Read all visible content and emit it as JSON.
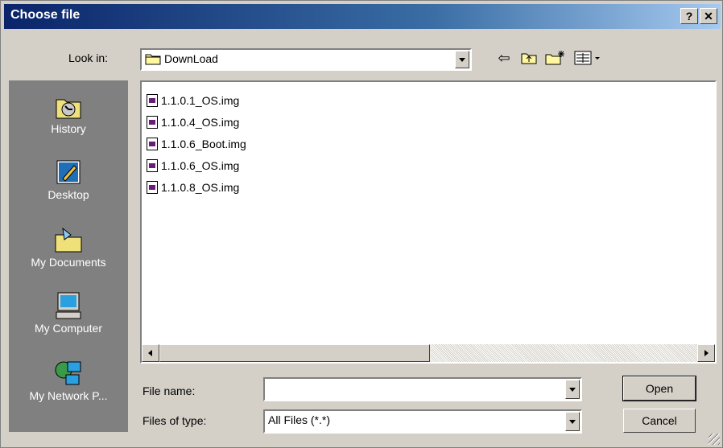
{
  "window": {
    "title": "Choose file",
    "help_label": "?",
    "close_label": "✕"
  },
  "toolbar": {
    "look_in_label": "Look in:",
    "look_in_value": "DownLoad",
    "back_icon": "⇦",
    "up_folder_icon": "up-folder",
    "new_folder_icon": "new-folder",
    "view_menu_icon": "view-menu"
  },
  "places": [
    {
      "label": "History",
      "icon": "history-icon"
    },
    {
      "label": "Desktop",
      "icon": "desktop-icon"
    },
    {
      "label": "My Documents",
      "icon": "my-documents-icon"
    },
    {
      "label": "My Computer",
      "icon": "my-computer-icon"
    },
    {
      "label": "My Network P...",
      "icon": "my-network-places-icon"
    }
  ],
  "files": [
    {
      "name": "1.1.0.1_OS.img"
    },
    {
      "name": "1.1.0.4_OS.img"
    },
    {
      "name": "1.1.0.6_Boot.img"
    },
    {
      "name": "1.1.0.6_OS.img"
    },
    {
      "name": "1.1.0.8_OS.img"
    }
  ],
  "form": {
    "file_name_label": "File name:",
    "file_name_value": "",
    "files_of_type_label": "Files of type:",
    "files_of_type_value": "All Files (*.*)"
  },
  "buttons": {
    "open": "Open",
    "cancel": "Cancel"
  }
}
